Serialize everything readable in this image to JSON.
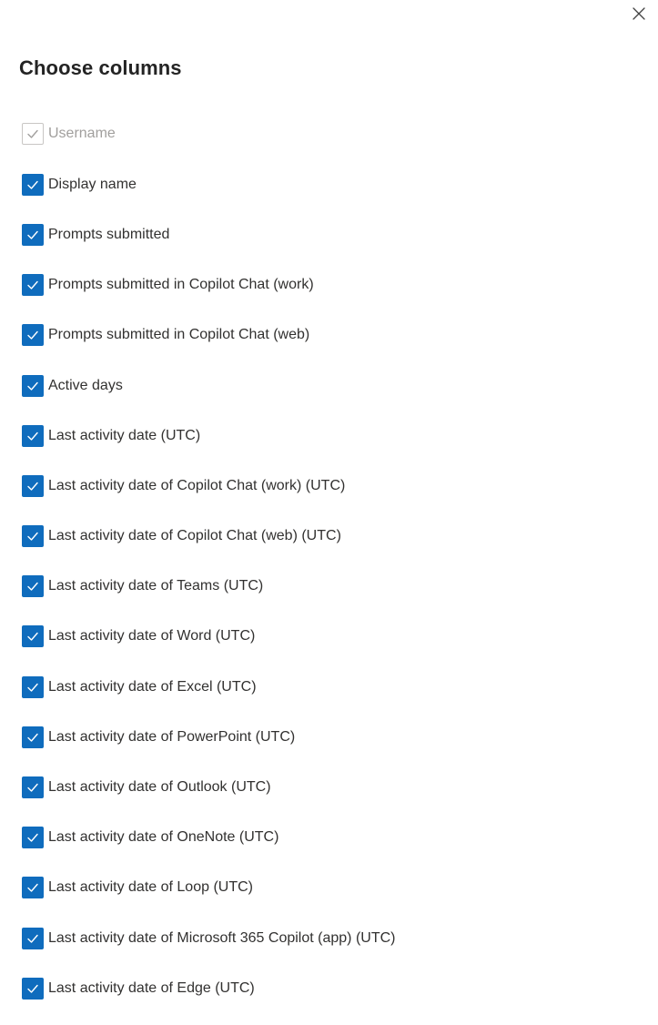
{
  "dialog": {
    "title": "Choose columns",
    "close_icon": "close-icon"
  },
  "columns": [
    {
      "label": "Username",
      "checked": true,
      "disabled": true
    },
    {
      "label": "Display name",
      "checked": true,
      "disabled": false
    },
    {
      "label": "Prompts submitted",
      "checked": true,
      "disabled": false
    },
    {
      "label": "Prompts submitted in Copilot Chat (work)",
      "checked": true,
      "disabled": false
    },
    {
      "label": "Prompts submitted in Copilot Chat (web)",
      "checked": true,
      "disabled": false
    },
    {
      "label": "Active days",
      "checked": true,
      "disabled": false
    },
    {
      "label": "Last activity date (UTC)",
      "checked": true,
      "disabled": false
    },
    {
      "label": "Last activity date of Copilot Chat (work) (UTC)",
      "checked": true,
      "disabled": false
    },
    {
      "label": "Last activity date of Copilot Chat (web) (UTC)",
      "checked": true,
      "disabled": false
    },
    {
      "label": "Last activity date of Teams (UTC)",
      "checked": true,
      "disabled": false
    },
    {
      "label": "Last activity date of Word (UTC)",
      "checked": true,
      "disabled": false
    },
    {
      "label": "Last activity date of Excel (UTC)",
      "checked": true,
      "disabled": false
    },
    {
      "label": "Last activity date of PowerPoint (UTC)",
      "checked": true,
      "disabled": false
    },
    {
      "label": "Last activity date of Outlook (UTC)",
      "checked": true,
      "disabled": false
    },
    {
      "label": "Last activity date of OneNote (UTC)",
      "checked": true,
      "disabled": false
    },
    {
      "label": "Last activity date of Loop (UTC)",
      "checked": true,
      "disabled": false
    },
    {
      "label": "Last activity date of Microsoft 365 Copilot (app) (UTC)",
      "checked": true,
      "disabled": false
    },
    {
      "label": "Last activity date of Edge (UTC)",
      "checked": true,
      "disabled": false
    }
  ],
  "colors": {
    "accent": "#0f6cbd",
    "disabled_text": "#a19f9d",
    "text": "#323130"
  }
}
